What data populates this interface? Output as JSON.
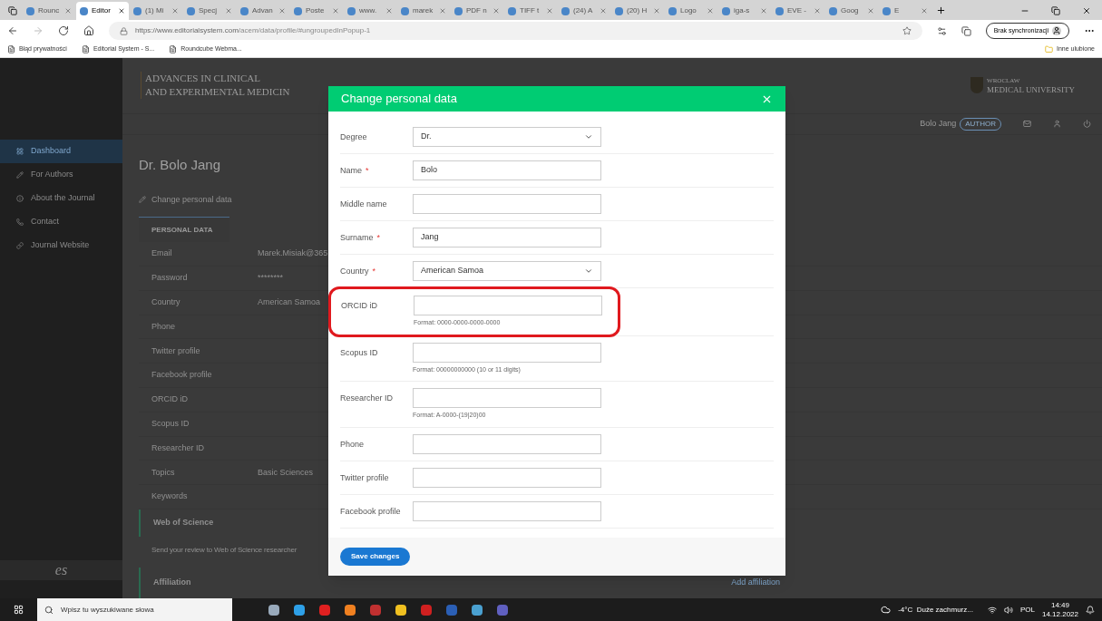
{
  "browser": {
    "tabs": [
      {
        "label": "Rounc",
        "selected": false
      },
      {
        "label": "Editor",
        "selected": true
      },
      {
        "label": "(1) Mi",
        "selected": false
      },
      {
        "label": "Specj",
        "selected": false
      },
      {
        "label": "Advan",
        "selected": false
      },
      {
        "label": "Poste",
        "selected": false
      },
      {
        "label": "www.",
        "selected": false
      },
      {
        "label": "marek",
        "selected": false
      },
      {
        "label": "PDF n",
        "selected": false
      },
      {
        "label": "TIFF t",
        "selected": false
      },
      {
        "label": "(24) A",
        "selected": false
      },
      {
        "label": "(20) H",
        "selected": false
      },
      {
        "label": "Logo",
        "selected": false
      },
      {
        "label": "iga-s",
        "selected": false
      },
      {
        "label": "EVE -",
        "selected": false
      },
      {
        "label": "Goog",
        "selected": false
      },
      {
        "label": "E",
        "selected": false
      }
    ],
    "url_host": "https://www.editorialsystem.com",
    "url_path": "/acem/data/profile/#ungroupedInPopup-1",
    "sync_button": "Brak synchronizacji",
    "bookmarks": [
      "Błąd prywatności",
      "Editorial System - S...",
      "Roundcube Webma..."
    ],
    "other_favorites": "Inne ulubione"
  },
  "sidebar": {
    "items": [
      {
        "label": "Dashboard",
        "selected": true
      },
      {
        "label": "For Authors",
        "selected": false
      },
      {
        "label": "About the Journal",
        "selected": false
      },
      {
        "label": "Contact",
        "selected": false
      },
      {
        "label": "Journal Website",
        "selected": false
      }
    ],
    "footer_logo": "es"
  },
  "header": {
    "journal_line_1": "ADVANCES IN CLINICAL",
    "journal_line_2": "AND EXPERIMENTAL MEDICIN",
    "university_small": "WROCLAW",
    "university": "MEDICAL UNIVERSITY",
    "user": "Bolo Jang",
    "role": "AUTHOR"
  },
  "profile": {
    "title": "Dr. Bolo Jang",
    "edit_link": "Change personal data",
    "tab": "PERSONAL DATA",
    "rows": [
      {
        "label": "Email",
        "value": "Marek.Misiak@365"
      },
      {
        "label": "Password",
        "value": "********"
      },
      {
        "label": "Country",
        "value": "American Samoa"
      },
      {
        "label": "Phone"
      },
      {
        "label": "Twitter profile"
      },
      {
        "label": "Facebook profile"
      },
      {
        "label": "ORCID iD"
      },
      {
        "label": "Scopus ID"
      },
      {
        "label": "Researcher ID"
      },
      {
        "label": "Topics",
        "value": "Basic Sciences"
      },
      {
        "label": "Keywords"
      }
    ],
    "wos_title": "Web of Science",
    "wos_text": "Send your review to Web of Science researcher",
    "affiliation_title": "Affiliation",
    "add_affiliation": "Add affiliation"
  },
  "dialog": {
    "title": "Change personal data",
    "fields": [
      {
        "kind": "select",
        "label": "Degree",
        "required": false,
        "value": "Dr."
      },
      {
        "kind": "text",
        "label": "Name",
        "required": true,
        "value": "Bolo"
      },
      {
        "kind": "text",
        "label": "Middle name",
        "required": false
      },
      {
        "kind": "text",
        "label": "Surname",
        "required": true,
        "value": "Jang"
      },
      {
        "kind": "select",
        "label": "Country",
        "required": true,
        "value": "American Samoa"
      },
      {
        "kind": "text",
        "label": "ORCID iD",
        "required": false,
        "hint": "Format: 0000-0000-0000-0000",
        "highlighted": true
      },
      {
        "kind": "text",
        "label": "Scopus ID",
        "required": false,
        "hint": "Format: 00000000000 (10 or 11 digits)"
      },
      {
        "kind": "text",
        "label": "Researcher ID",
        "required": false,
        "hint": "Format: A-0000-(19|20)00"
      },
      {
        "kind": "text",
        "label": "Phone",
        "required": false
      },
      {
        "kind": "text",
        "label": "Twitter profile",
        "required": false
      },
      {
        "kind": "text",
        "label": "Facebook profile",
        "required": false
      }
    ],
    "required_mark": "*",
    "save": "Save changes"
  },
  "taskbar": {
    "search_placeholder": "Wpisz tu wyszukiwane słowa",
    "weather": "-4°C  Duże zachmurz...",
    "language": "POL",
    "time": "14:49",
    "date": "14.12.2022"
  }
}
